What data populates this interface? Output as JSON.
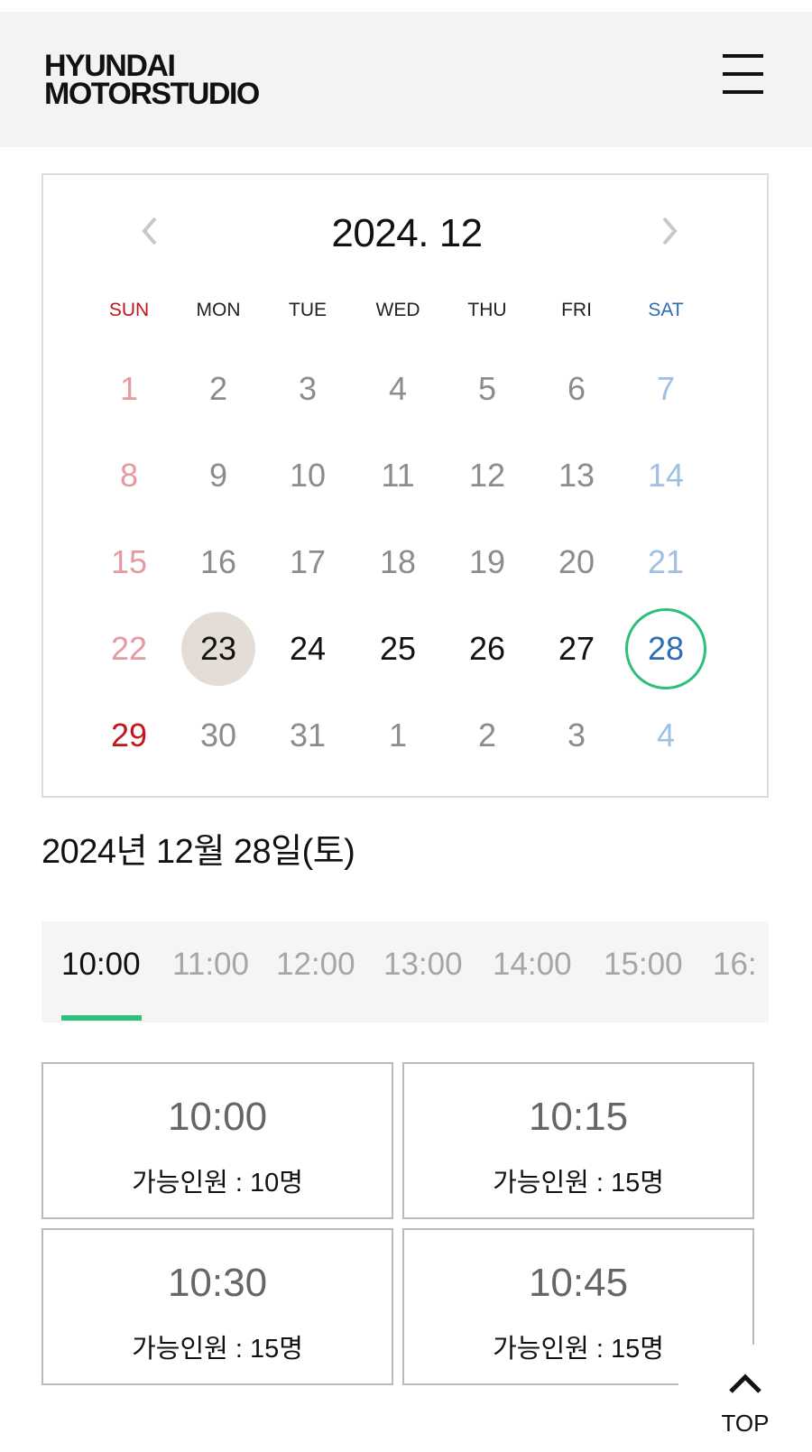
{
  "header": {
    "logo_line1": "HYUNDAI",
    "logo_line2": "MOTORSTUDIO"
  },
  "calendar": {
    "title": "2024. 12",
    "weekdays": [
      "SUN",
      "MON",
      "TUE",
      "WED",
      "THU",
      "FRI",
      "SAT"
    ],
    "weeks": [
      [
        "1",
        "2",
        "3",
        "4",
        "5",
        "6",
        "7"
      ],
      [
        "8",
        "9",
        "10",
        "11",
        "12",
        "13",
        "14"
      ],
      [
        "15",
        "16",
        "17",
        "18",
        "19",
        "20",
        "21"
      ],
      [
        "22",
        "23",
        "24",
        "25",
        "26",
        "27",
        "28"
      ],
      [
        "29",
        "30",
        "31",
        "1",
        "2",
        "3",
        "4"
      ]
    ],
    "today": "23",
    "selected": "28",
    "colors": {
      "sunday": "#c1161c",
      "saturday": "#2e6db4",
      "selected_ring": "#2dbf7c",
      "today_bg": "#e4ddd6"
    }
  },
  "selected_date_label": "2024년 12월 28일(토)",
  "time_tabs": [
    "10:00",
    "11:00",
    "12:00",
    "13:00",
    "14:00",
    "15:00",
    "16:"
  ],
  "active_tab": "10:00",
  "slots": [
    {
      "time": "10:00",
      "capacity": "가능인원 : 10명"
    },
    {
      "time": "10:15",
      "capacity": "가능인원 : 15명"
    },
    {
      "time": "10:30",
      "capacity": "가능인원 : 15명"
    },
    {
      "time": "10:45",
      "capacity": "가능인원 : 15명"
    }
  ],
  "top_button": {
    "label": "TOP"
  },
  "icons": [
    "menu-icon",
    "chevron-left-icon",
    "chevron-right-icon",
    "chevron-up-icon"
  ]
}
